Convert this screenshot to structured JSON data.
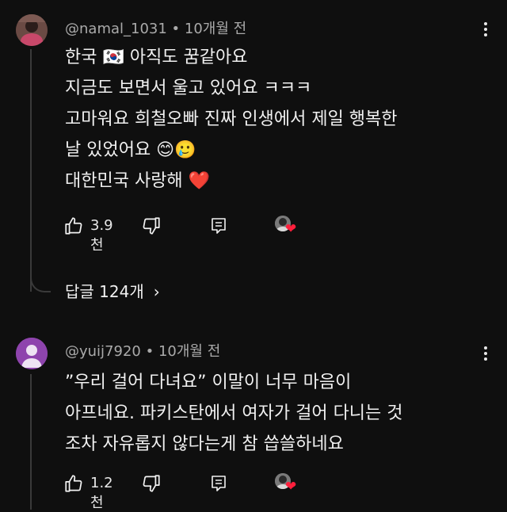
{
  "comments": [
    {
      "author": "@namal_1031",
      "separator": "•",
      "time": "10개월 전",
      "lines": [
        "한국 🇰🇷 아직도 꿈같아요",
        "지금도 보면서 울고 있어요 ㅋㅋㅋ",
        "고마워요 희철오빠 진짜 인생에서 제일 행복한",
        "날 있었어요 😊🥲",
        "대한민국 사랑해 ❤️"
      ],
      "likes": "3.9천",
      "replies_label": "답글 124개",
      "replies_chevron": "›",
      "creator_heart": "❤"
    },
    {
      "author": "@yuij7920",
      "separator": "•",
      "time": "10개월 전",
      "lines": [
        "”우리 걸어 다녀요” 이말이 너무 마음이",
        "아프네요. 파키스탄에서 여자가 걸어 다니는 것",
        "조차 자유롭지 않다는게 참 씁쓸하네요"
      ],
      "likes": "1.2천",
      "creator_heart": "❤"
    }
  ],
  "colors": {
    "background": "#0f0f0f",
    "text": "#f1f1f1",
    "meta": "#aaaaaa",
    "thread": "#3a3a3a",
    "heart": "#ff1f3c",
    "avatar2": "#8e44ad"
  },
  "icons": {
    "like": "thumb-up-icon",
    "dislike": "thumb-down-icon",
    "reply": "reply-icon",
    "more": "more-vert-icon"
  }
}
